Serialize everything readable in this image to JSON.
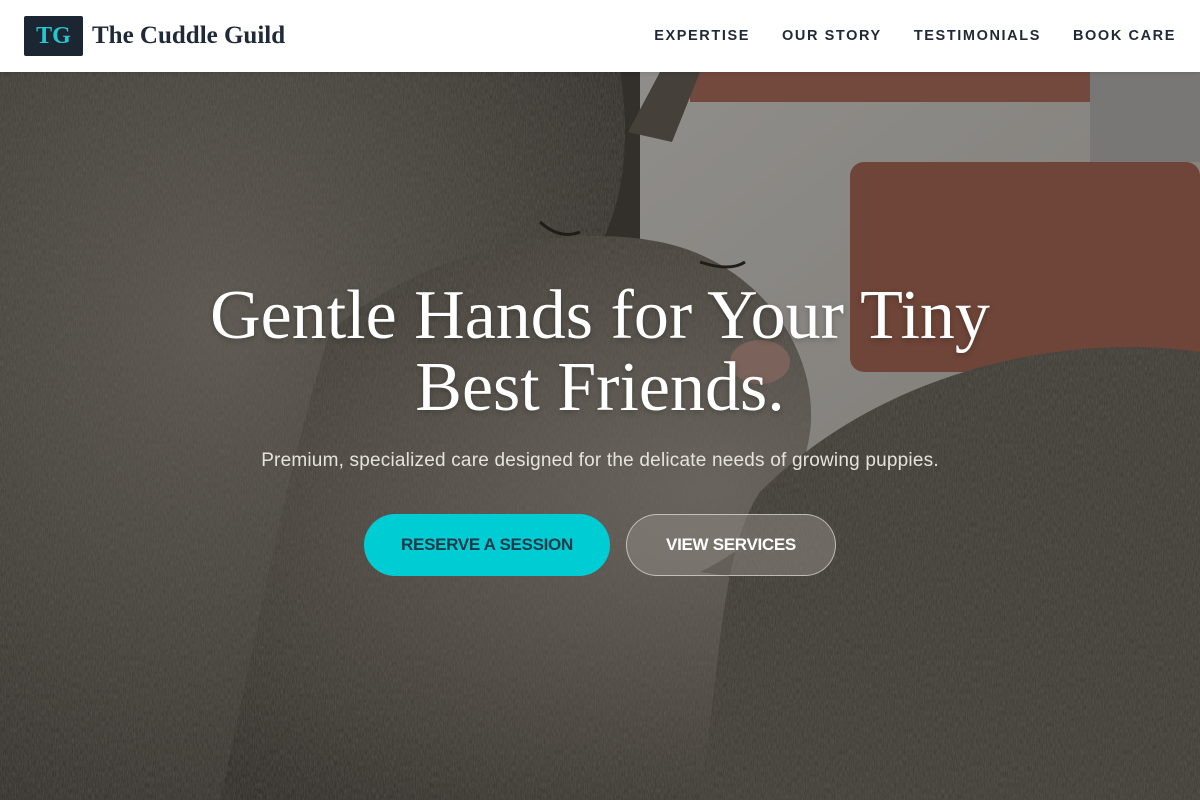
{
  "brand": {
    "mark": "TG",
    "name": "The Cuddle Guild"
  },
  "nav": {
    "items": [
      {
        "label": "EXPERTISE"
      },
      {
        "label": "OUR STORY"
      },
      {
        "label": "TESTIMONIALS"
      },
      {
        "label": "BOOK CARE"
      }
    ]
  },
  "hero": {
    "title": "Gentle Hands for Your Tiny Best Friends.",
    "subtitle": "Premium, specialized care designed for the delicate needs of growing puppies.",
    "primary_cta": "RESERVE A SESSION",
    "secondary_cta": "VIEW SERVICES",
    "background_image": "two tabby cats cuddling photo"
  },
  "colors": {
    "accent": "#00ccd3",
    "brand_mark_bg": "#1c2633",
    "text_dark": "#1f2937"
  }
}
